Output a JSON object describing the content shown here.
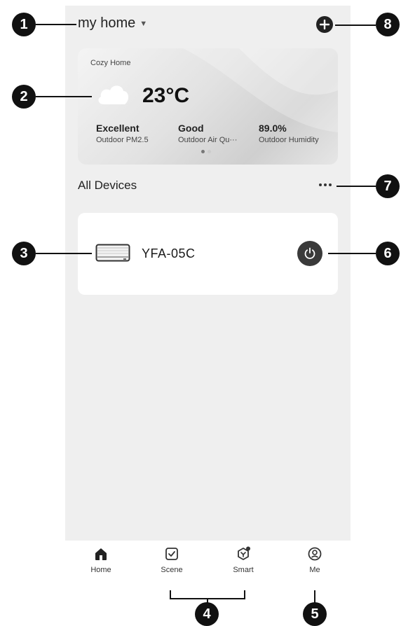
{
  "header": {
    "home_name": "my home",
    "caret": "▼"
  },
  "weather": {
    "location": "Cozy Home",
    "temperature": "23°C",
    "stats": [
      {
        "value": "Excellent",
        "label": "Outdoor PM2.5"
      },
      {
        "value": "Good",
        "label": "Outdoor Air Qu···"
      },
      {
        "value": "89.0%",
        "label": "Outdoor Humidity"
      }
    ]
  },
  "devices": {
    "section_title": "All Devices",
    "items": [
      {
        "name": "YFA-05C"
      }
    ]
  },
  "tabbar": {
    "tabs": [
      {
        "label": "Home"
      },
      {
        "label": "Scene"
      },
      {
        "label": "Smart"
      },
      {
        "label": "Me"
      }
    ]
  },
  "callouts": [
    "1",
    "2",
    "3",
    "4",
    "5",
    "6",
    "7",
    "8"
  ],
  "icons": {
    "add": "plus-circle-icon",
    "weather": "cloud-icon",
    "device": "air-conditioner-icon",
    "power": "power-icon",
    "more": "ellipsis-icon",
    "tabs": [
      "home-icon",
      "scene-checkbox-icon",
      "smart-icon",
      "profile-icon"
    ]
  },
  "colors": {
    "screen_bg": "#efefef",
    "card_bg": "#ffffff",
    "power_bg": "#3a3a3a",
    "callout_bg": "#111111"
  }
}
